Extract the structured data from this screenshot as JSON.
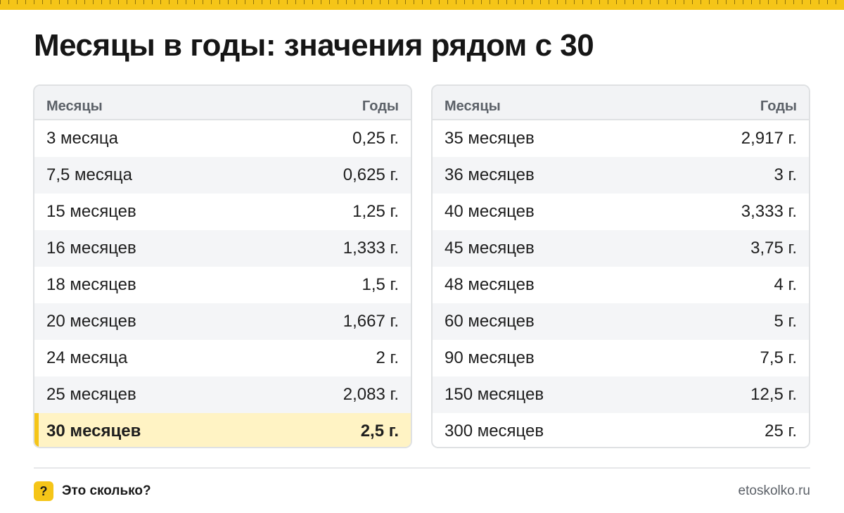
{
  "header": {
    "title": "Месяцы в годы: значения рядом с 30",
    "accent_color": "#f5c518"
  },
  "tables": {
    "left": {
      "col_months": "Месяцы",
      "col_years": "Годы",
      "rows": [
        {
          "months": "3 месяца",
          "years": "0,25 г."
        },
        {
          "months": "7,5 месяца",
          "years": "0,625 г."
        },
        {
          "months": "15 месяцев",
          "years": "1,25 г."
        },
        {
          "months": "16 месяцев",
          "years": "1,333 г."
        },
        {
          "months": "18 месяцев",
          "years": "1,5 г."
        },
        {
          "months": "20 месяцев",
          "years": "1,667 г."
        },
        {
          "months": "24 месяца",
          "years": "2 г."
        },
        {
          "months": "25 месяцев",
          "years": "2,083 г."
        },
        {
          "months": "30 месяцев",
          "years": "2,5 г.",
          "highlighted": true
        }
      ]
    },
    "right": {
      "col_months": "Месяцы",
      "col_years": "Годы",
      "rows": [
        {
          "months": "35 месяцев",
          "years": "2,917 г."
        },
        {
          "months": "36 месяцев",
          "years": "3 г."
        },
        {
          "months": "40 месяцев",
          "years": "3,333 г."
        },
        {
          "months": "45 месяцев",
          "years": "3,75 г."
        },
        {
          "months": "48 месяцев",
          "years": "4 г."
        },
        {
          "months": "60 месяцев",
          "years": "5 г."
        },
        {
          "months": "90 месяцев",
          "years": "7,5 г."
        },
        {
          "months": "150 месяцев",
          "years": "12,5 г."
        },
        {
          "months": "300 месяцев",
          "years": "25 г."
        }
      ]
    }
  },
  "footer": {
    "badge_symbol": "?",
    "badge_icon": "question-icon",
    "brand": "Это сколько?",
    "site": "etoskolko.ru"
  }
}
